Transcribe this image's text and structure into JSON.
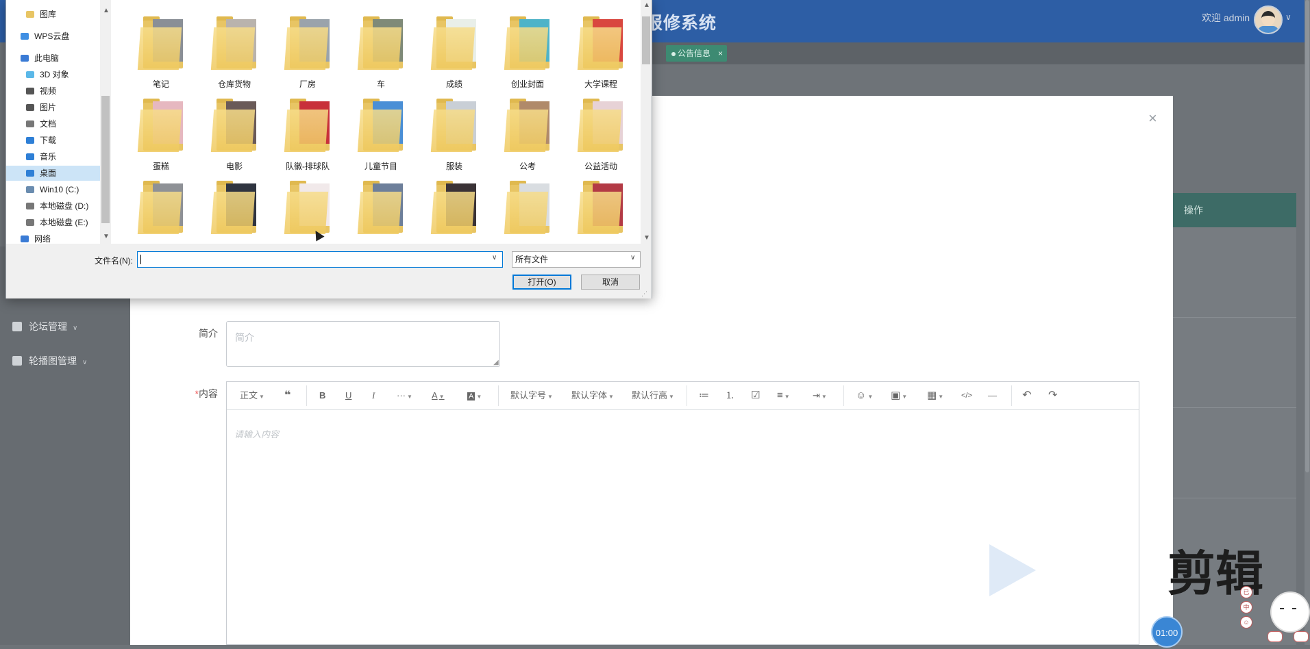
{
  "app": {
    "title": "报修系统",
    "welcome": "欢迎 admin",
    "tab_notice": "公告信息",
    "tab_close": "×",
    "sidebar": [
      {
        "label": "论坛管理",
        "icon": "forum-icon"
      },
      {
        "label": "轮播图管理",
        "icon": "carousel-icon"
      }
    ],
    "table_header": "操作"
  },
  "modal": {
    "close": "×",
    "intro_label": "简介",
    "intro_placeholder": "简介",
    "content_required": "*",
    "content_label": "内容",
    "editor_placeholder": "请输入内容",
    "toolbar": {
      "paragraph": "正文",
      "quote": "❝",
      "bold": "B",
      "underline": "U",
      "italic": "I",
      "more": "···",
      "font_color": "A",
      "bg_color": "A",
      "font_size": "默认字号",
      "font_family": "默认字体",
      "line_height": "默认行高",
      "bullet_list": "≔",
      "numbered_list": "⒈",
      "todo": "☑",
      "align": "≡",
      "indent": "⇥",
      "emoji": "☺",
      "image": "▣",
      "table": "▦",
      "code": "</>",
      "divider": "―",
      "undo": "↶",
      "redo": "↷"
    }
  },
  "overlay": {
    "watermark_text": "剪辑",
    "timer": "01:00",
    "mini_tools": [
      "已",
      "中",
      "☺"
    ]
  },
  "dialog": {
    "nav_items": [
      {
        "label": "图库",
        "icon": "folder-icon",
        "color": "#e8c564"
      },
      {
        "label": "WPS云盘",
        "icon": "cloud-icon",
        "color": "#3f8fe3"
      },
      {
        "label": "此电脑",
        "icon": "computer-icon",
        "color": "#3a7bd5"
      },
      {
        "label": "3D 对象",
        "icon": "cube-icon",
        "color": "#5bb8e8"
      },
      {
        "label": "视频",
        "icon": "video-icon",
        "color": "#555555"
      },
      {
        "label": "图片",
        "icon": "picture-icon",
        "color": "#555555"
      },
      {
        "label": "文档",
        "icon": "document-icon",
        "color": "#777777"
      },
      {
        "label": "下载",
        "icon": "download-icon",
        "color": "#2e7fd6"
      },
      {
        "label": "音乐",
        "icon": "music-icon",
        "color": "#2e7fd6"
      },
      {
        "label": "桌面",
        "icon": "desktop-icon",
        "color": "#2e7fd6"
      },
      {
        "label": "Win10 (C:)",
        "icon": "drive-icon",
        "color": "#6a8caf"
      },
      {
        "label": "本地磁盘 (D:)",
        "icon": "drive-icon",
        "color": "#777777"
      },
      {
        "label": "本地磁盘 (E:)",
        "icon": "drive-icon",
        "color": "#777777"
      },
      {
        "label": "网络",
        "icon": "network-icon",
        "color": "#3a7bd5"
      }
    ],
    "folders": [
      {
        "label": "笔记",
        "color": "#8a8f96"
      },
      {
        "label": "仓库货物",
        "color": "#b9b3ad"
      },
      {
        "label": "厂房",
        "color": "#9aa3ab"
      },
      {
        "label": "车",
        "color": "#7f8a78"
      },
      {
        "label": "成绩",
        "color": "#e9efe9"
      },
      {
        "label": "创业封面",
        "color": "#4eb3c8"
      },
      {
        "label": "大学课程",
        "color": "#d9473f"
      },
      {
        "label": "蛋糕",
        "color": "#e6b8c0"
      },
      {
        "label": "电影",
        "color": "#6a5a58"
      },
      {
        "label": "队徽-排球队",
        "color": "#c8303a"
      },
      {
        "label": "儿童节目",
        "color": "#4a8fd6"
      },
      {
        "label": "服装",
        "color": "#c9cfd6"
      },
      {
        "label": "公考",
        "color": "#b08a6a"
      },
      {
        "label": "公益活动",
        "color": "#e7d2d6"
      },
      {
        "label": "",
        "color": "#8e9196"
      },
      {
        "label": "",
        "color": "#2f3440"
      },
      {
        "label": "",
        "color": "#f1e9ea"
      },
      {
        "label": "",
        "color": "#6d7f9a"
      },
      {
        "label": "",
        "color": "#3a3236"
      },
      {
        "label": "",
        "color": "#d9dde1"
      },
      {
        "label": "",
        "color": "#b33a45"
      }
    ],
    "filename_label": "文件名(N):",
    "filename_value": "",
    "filetype": "所有文件",
    "open_button": "打开(O)",
    "cancel_button": "取消",
    "scroll_up": "▲",
    "scroll_down": "▼",
    "dropdown_arrow": "∨"
  }
}
